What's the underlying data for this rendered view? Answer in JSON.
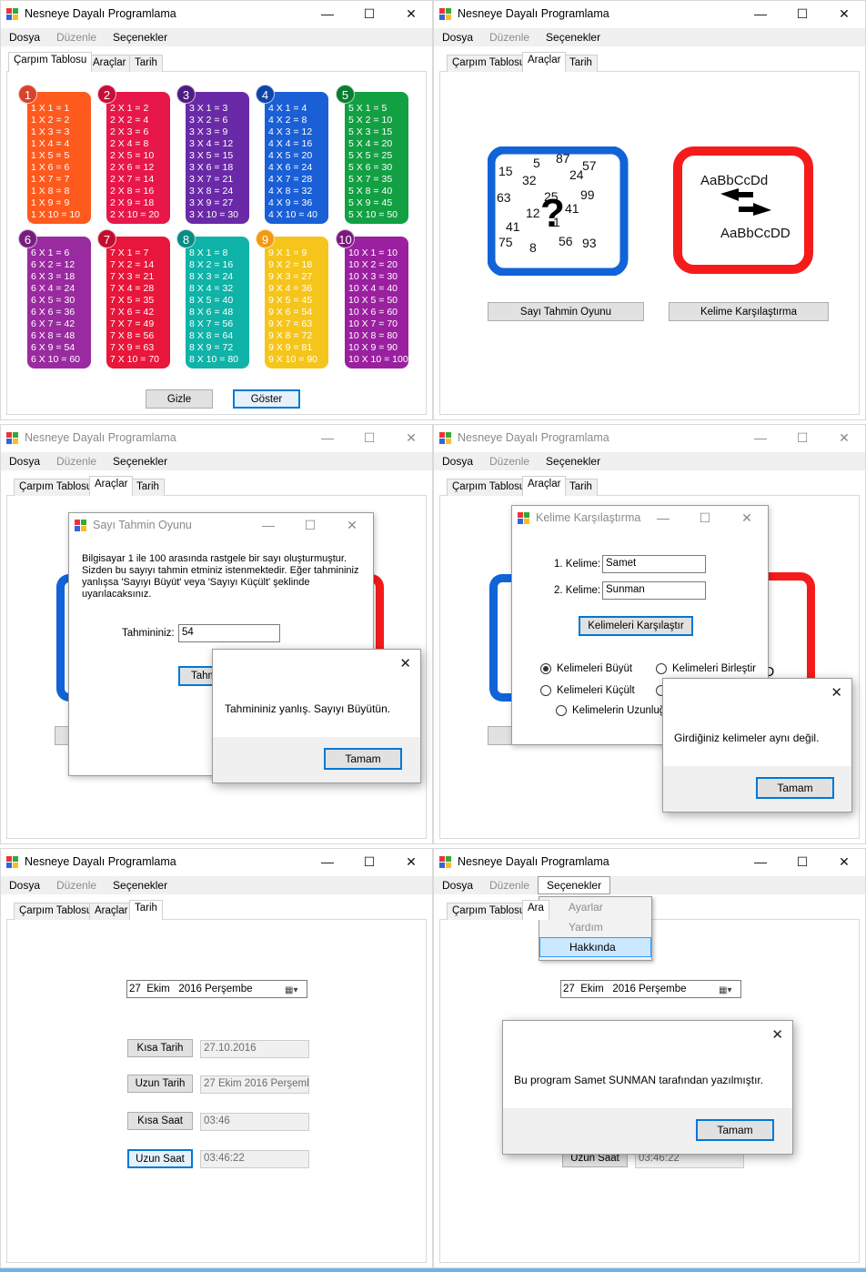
{
  "app": {
    "title": "Nesneye Dayalı Programlama",
    "menu": [
      "Dosya",
      "Düzenle",
      "Seçenekler"
    ],
    "tabs": [
      "Çarpım Tablosu",
      "Araçlar",
      "Tarih"
    ],
    "minimize": "—",
    "maximize": "☐",
    "close": "✕"
  },
  "panel1": {
    "cards": [
      {
        "n": "1",
        "color": "#ff5a1e",
        "badge": "#d8432e",
        "lines": [
          "1 X 1 = 1",
          "1 X 2 = 2",
          "1 X 3 = 3",
          "1 X 4 = 4",
          "1 X 5 = 5",
          "1 X 6 = 6",
          "1 X 7 = 7",
          "1 X 8 = 8",
          "1 X 9 = 9",
          "1 X 10 = 10"
        ]
      },
      {
        "n": "2",
        "color": "#e8174a",
        "badge": "#c40f3a",
        "lines": [
          "2 X 1 = 2",
          "2 X 2 = 4",
          "2 X 3 = 6",
          "2 X 4 = 8",
          "2 X 5 = 10",
          "2 X 6 = 12",
          "2 X 7 = 14",
          "2 X 8 = 16",
          "2 X 9 = 18",
          "2 X 10 = 20"
        ]
      },
      {
        "n": "3",
        "color": "#6a2aa8",
        "badge": "#4e1d82",
        "lines": [
          "3 X 1 = 3",
          "3 X 2 = 6",
          "3 X 3 = 9",
          "3 X 4 = 12",
          "3 X 5 = 15",
          "3 X 6 = 18",
          "3 X 7 = 21",
          "3 X 8 = 24",
          "3 X 9 = 27",
          "3 X 10 = 30"
        ]
      },
      {
        "n": "4",
        "color": "#1a5fd6",
        "badge": "#0f44a8",
        "lines": [
          "4 X 1 = 4",
          "4 X 2 = 8",
          "4 X 3 = 12",
          "4 X 4 = 16",
          "4 X 5 = 20",
          "4 X 6 = 24",
          "4 X 7 = 28",
          "4 X 8 = 32",
          "4 X 9 = 36",
          "4 X 10 = 40"
        ]
      },
      {
        "n": "5",
        "color": "#12a043",
        "badge": "#0b7c31",
        "lines": [
          "5 X 1 = 5",
          "5 X 2 = 10",
          "5 X 3 = 15",
          "5 X 4 = 20",
          "5 X 5 = 25",
          "5 X 6 = 30",
          "5 X 7 = 35",
          "5 X 8 = 40",
          "5 X 9 = 45",
          "5 X 10 = 50"
        ]
      },
      {
        "n": "6",
        "color": "#9a2aa0",
        "badge": "#761e7c",
        "lines": [
          "6 X 1 = 6",
          "6 X 2 = 12",
          "6 X 3 = 18",
          "6 X 4 = 24",
          "6 X 5 = 30",
          "6 X 6 = 36",
          "6 X 7 = 42",
          "6 X 8 = 48",
          "6 X 9 = 54",
          "6 X 10 = 60"
        ]
      },
      {
        "n": "7",
        "color": "#e8163a",
        "badge": "#c20e2e",
        "lines": [
          "7 X 1 = 7",
          "7 X 2 = 14",
          "7 X 3 = 21",
          "7 X 4 = 28",
          "7 X 5 = 35",
          "7 X 6 = 42",
          "7 X 7 = 49",
          "7 X 8 = 56",
          "7 X 9 = 63",
          "7 X 10 = 70"
        ]
      },
      {
        "n": "8",
        "color": "#0fb3a8",
        "badge": "#0a8c84",
        "lines": [
          "8 X 1 = 8",
          "8 X 2 = 16",
          "8 X 3 = 24",
          "8 X 4 = 32",
          "8 X 5 = 40",
          "8 X 6 = 48",
          "8 X 7 = 56",
          "8 X 8 = 64",
          "8 X 9 = 72",
          "8 X 10 = 80"
        ]
      },
      {
        "n": "9",
        "color": "#f6c51b",
        "badge": "#f39a12",
        "lines": [
          "9 X 1 = 9",
          "9 X 2 = 18",
          "9 X 3 = 27",
          "9 X 4 = 36",
          "9 X 5 = 45",
          "9 X 6 = 54",
          "9 X 7 = 63",
          "9 X 8 = 72",
          "9 X 9 = 81",
          "9 X 10 = 90"
        ]
      },
      {
        "n": "10",
        "color": "#9a20a0",
        "badge": "#7a187e",
        "lines": [
          "10 X 1 = 10",
          "10 X 2 = 20",
          "10 X 3 = 30",
          "10 X 4 = 40",
          "10 X 5 = 50",
          "10 X 6 = 60",
          "10 X 7 = 70",
          "10 X 8 = 80",
          "10 X 9 = 90",
          "10 X 10 = 100"
        ]
      }
    ],
    "hide_btn": "Gizle",
    "show_btn": "Göster"
  },
  "panel2": {
    "guess_btn": "Sayı Tahmin Oyunu",
    "compare_btn": "Kelime Karşılaştırma",
    "icon_numbers": [
      "15",
      "5",
      "87",
      "57",
      "32",
      "24",
      "63",
      "99",
      "12",
      "41",
      "1",
      "41",
      "75",
      "8",
      "56",
      "93",
      "25"
    ],
    "icon_qmark": "?",
    "icon_word_top": "AaBbCcDd",
    "icon_word_bottom": "AaBbCcDD"
  },
  "panel3": {
    "dialog_title": "Sayı Tahmin Oyunu",
    "intro": "Bilgisayar 1 ile 100 arasında rastgele bir sayı oluşturmuştur. Sizden bu sayıyı tahmin etminiz istenmektedir. Eğer tahmininiz yanlışsa 'Sayıyı Büyüt' veya 'Sayıyı Küçült' şeklinde uyarılacaksınız.",
    "guess_label": "Tahmininiz:",
    "guess_value": "54",
    "partial_btn": "Tahm",
    "msg": "Tahmininiz yanlış. Sayıyı Büyütün.",
    "ok": "Tamam"
  },
  "panel4": {
    "dialog_title": "Kelime Karşılaştırma",
    "word1_label": "1. Kelime:",
    "word1": "Samet",
    "word2_label": "2. Kelime:",
    "word2": "Sunman",
    "compare_btn": "Kelimeleri Karşılaştır",
    "radio_upper": "Kelimeleri Büyüt",
    "radio_join": "Kelimeleri Birleştir",
    "radio_lower": "Kelimeleri Küçült",
    "radio_length": "Kelimelerin Uzunluğu",
    "bg_d": "d",
    "bg_cdd": "cDD",
    "msg": "Girdiğiniz kelimeler aynı değil.",
    "ok": "Tamam"
  },
  "panel5": {
    "date_day": "27",
    "date_month": "Ekim",
    "date_rest": "2016 Perşembe",
    "short_date_btn": "Kısa Tarih",
    "short_date": "27.10.2016",
    "long_date_btn": "Uzun Tarih",
    "long_date": "27 Ekim 2016 Perşembe",
    "short_time_btn": "Kısa Saat",
    "short_time": "03:46",
    "long_time_btn": "Uzun Saat",
    "long_time": "03:46:22"
  },
  "panel6": {
    "dropdown": [
      "Ayarlar",
      "Yardım",
      "Hakkında"
    ],
    "tab_partial": "Ara",
    "msg": "Bu program Samet SUNMAN tarafından yazılmıştır.",
    "ok": "Tamam"
  }
}
